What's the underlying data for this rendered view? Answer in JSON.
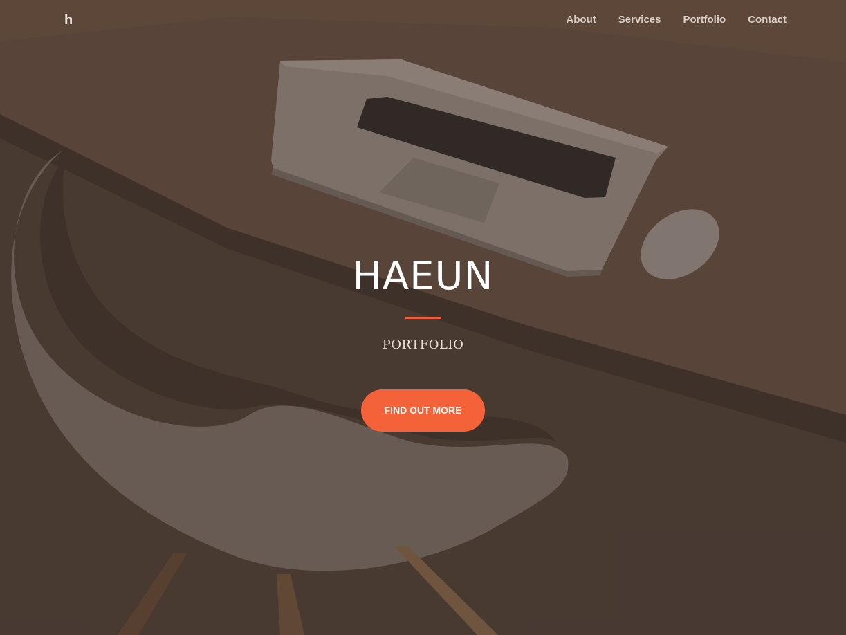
{
  "navbar": {
    "brand": "h",
    "links": [
      {
        "label": "About"
      },
      {
        "label": "Services"
      },
      {
        "label": "Portfolio"
      },
      {
        "label": "Contact"
      }
    ]
  },
  "hero": {
    "title": "HAEUN",
    "subtitle": "PORTFOLIO",
    "cta_label": "FIND OUT MORE"
  },
  "colors": {
    "accent": "#f4623a",
    "overlay": "#4e4038",
    "text": "#ffffff"
  }
}
